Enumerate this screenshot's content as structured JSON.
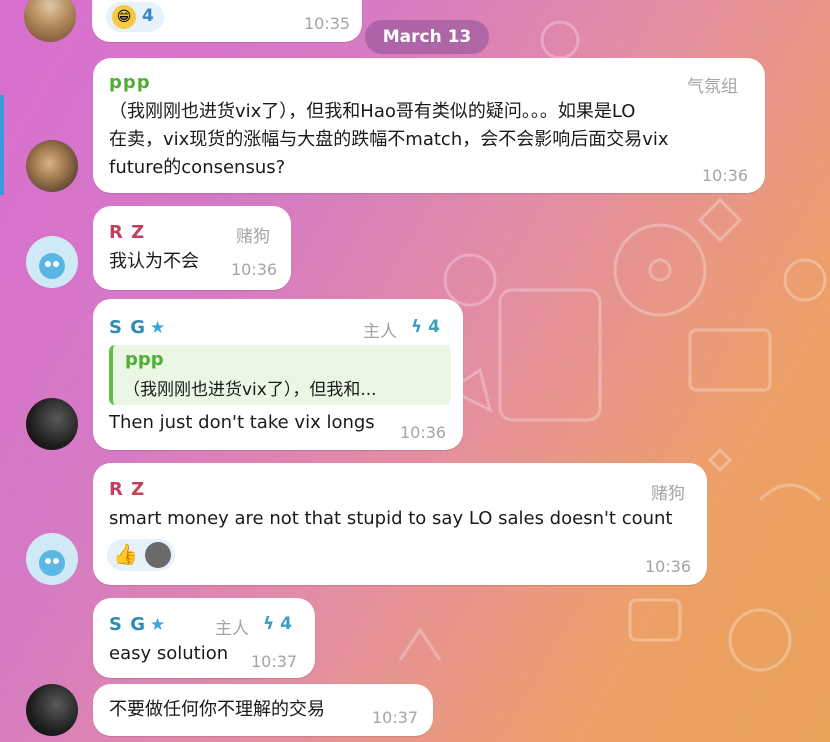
{
  "date_pill": "March 13",
  "prev_message": {
    "reaction_count": "4",
    "time": "10:35"
  },
  "messages": [
    {
      "name": "ppp",
      "role": "气氛组",
      "lines": [
        "（我刚刚也进货vix了），但我和Hao哥有类似的疑问。。。如果是LO",
        "在卖，vix现货的涨幅与大盘的跌幅不match，会不会影响后面交易vix",
        "future的consensus?"
      ],
      "time": "10:36"
    },
    {
      "name": "R Z",
      "role": "赌狗",
      "text": "我认为不会",
      "time": "10:36"
    },
    {
      "name": "S G",
      "role": "主人",
      "boost_count": "4",
      "reply_name": "ppp",
      "reply_text": "（我刚刚也进货vix了），但我和...",
      "text": "Then just don't take vix longs",
      "time": "10:36"
    },
    {
      "name": "R Z",
      "role": "赌狗",
      "text": "smart money are not that stupid to say LO sales doesn't count",
      "reaction_glyph": "👍",
      "time": "10:36"
    },
    {
      "name": "S G",
      "role": "主人",
      "boost_count": "4",
      "text": "easy solution",
      "time": "10:37"
    },
    {
      "text": "不要做任何你不理解的交易",
      "time": "10:37"
    }
  ],
  "colors": {
    "ppp": "#4fae33",
    "rz": "#c2405a",
    "sg": "#2e8cb3",
    "bubble": "#ffffff",
    "time": "#a4a4a4"
  },
  "icons": [
    "grinning-face-icon",
    "star-icon",
    "boost-bolt-icon",
    "thumbs-up-icon"
  ]
}
